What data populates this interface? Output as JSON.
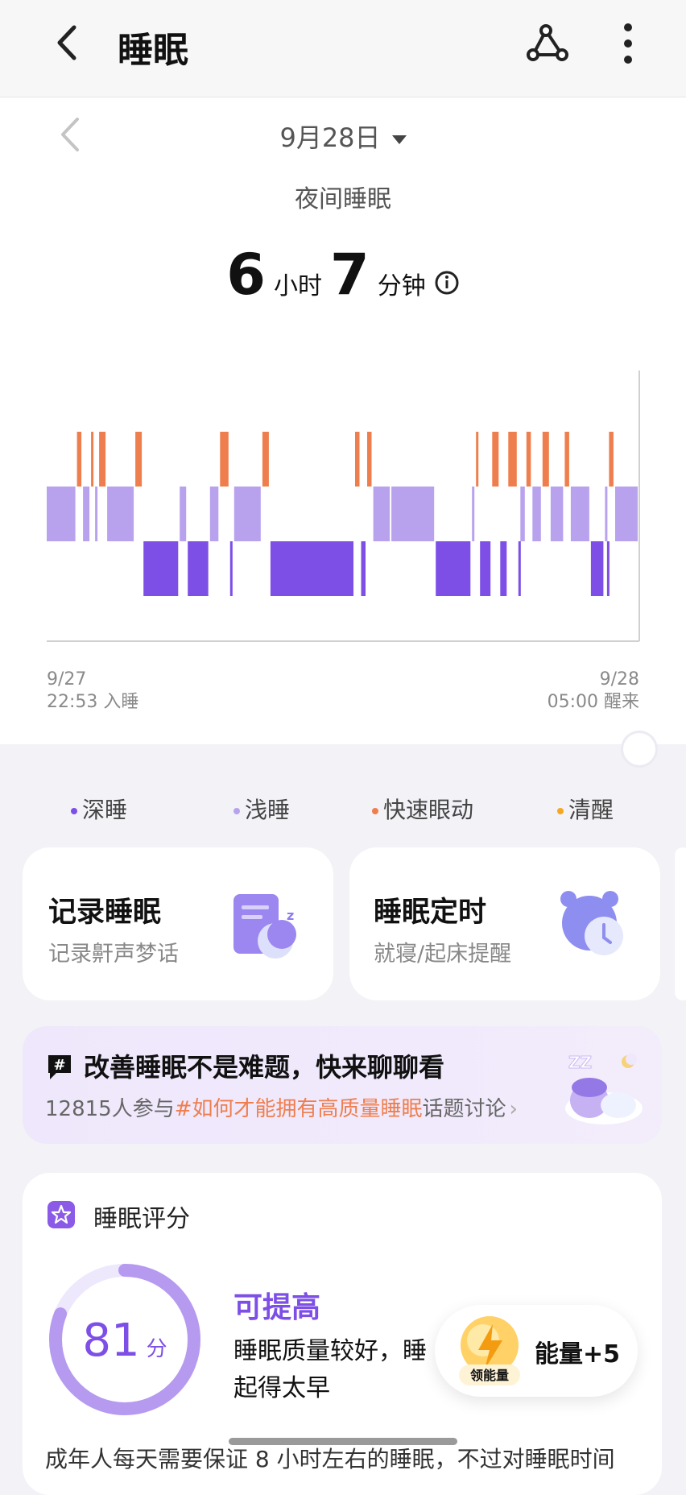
{
  "header": {
    "title": "睡眠",
    "back_icon": "chevron-left-icon",
    "share_icon": "share-nodes-icon",
    "more_icon": "more-vertical-icon"
  },
  "date_nav": {
    "date": "9月28日"
  },
  "summary": {
    "subtitle": "夜间睡眠",
    "hours": "6",
    "hours_unit": "小时",
    "minutes": "7",
    "minutes_unit": "分钟"
  },
  "chart": {
    "start_date": "9/27",
    "start_label": "22:53 入睡",
    "end_date": "9/28",
    "end_label": "05:00 醒来",
    "colors": {
      "deep": "#7d4fe6",
      "light": "#b8a2ee",
      "rem": "#ef7e4e",
      "awake": "#f5a623"
    },
    "segments": [
      {
        "stage": "light",
        "start": 0,
        "end": 15
      },
      {
        "stage": "rem",
        "start": 15,
        "end": 18
      },
      {
        "stage": "light",
        "start": 18,
        "end": 22
      },
      {
        "stage": "rem",
        "start": 22,
        "end": 24
      },
      {
        "stage": "light",
        "start": 24,
        "end": 26
      },
      {
        "stage": "rem",
        "start": 26,
        "end": 30
      },
      {
        "stage": "light",
        "start": 30,
        "end": 44
      },
      {
        "stage": "rem",
        "start": 44,
        "end": 48
      },
      {
        "stage": "deep",
        "start": 48,
        "end": 66
      },
      {
        "stage": "light",
        "start": 66,
        "end": 70
      },
      {
        "stage": "deep",
        "start": 70,
        "end": 81
      },
      {
        "stage": "light",
        "start": 81,
        "end": 86
      },
      {
        "stage": "rem",
        "start": 86,
        "end": 91
      },
      {
        "stage": "deep",
        "start": 91,
        "end": 93
      },
      {
        "stage": "light",
        "start": 93,
        "end": 107
      },
      {
        "stage": "rem",
        "start": 107,
        "end": 111
      },
      {
        "stage": "deep",
        "start": 111,
        "end": 153
      },
      {
        "stage": "rem",
        "start": 153,
        "end": 156
      },
      {
        "stage": "deep",
        "start": 156,
        "end": 159
      },
      {
        "stage": "rem",
        "start": 159,
        "end": 162
      },
      {
        "stage": "light",
        "start": 162,
        "end": 171
      },
      {
        "stage": "light",
        "start": 171,
        "end": 193
      },
      {
        "stage": "deep",
        "start": 193,
        "end": 211
      },
      {
        "stage": "light",
        "start": 211,
        "end": 213
      },
      {
        "stage": "rem",
        "start": 213,
        "end": 215
      },
      {
        "stage": "deep",
        "start": 215,
        "end": 221
      },
      {
        "stage": "rem",
        "start": 221,
        "end": 225
      },
      {
        "stage": "deep",
        "start": 225,
        "end": 229
      },
      {
        "stage": "rem",
        "start": 229,
        "end": 234
      },
      {
        "stage": "deep",
        "start": 234,
        "end": 235
      },
      {
        "stage": "light",
        "start": 235,
        "end": 238
      },
      {
        "stage": "rem",
        "start": 238,
        "end": 241
      },
      {
        "stage": "light",
        "start": 241,
        "end": 246
      },
      {
        "stage": "rem",
        "start": 246,
        "end": 250
      },
      {
        "stage": "light",
        "start": 250,
        "end": 257
      },
      {
        "stage": "rem",
        "start": 257,
        "end": 260
      },
      {
        "stage": "light",
        "start": 260,
        "end": 270
      },
      {
        "stage": "deep",
        "start": 270,
        "end": 277
      },
      {
        "stage": "light",
        "start": 277,
        "end": 278
      },
      {
        "stage": "deep",
        "start": 278,
        "end": 279
      },
      {
        "stage": "rem",
        "start": 279,
        "end": 282
      },
      {
        "stage": "light",
        "start": 282,
        "end": 294
      }
    ]
  },
  "legend": [
    {
      "label": "深睡",
      "color": "#7d4fe6"
    },
    {
      "label": "浅睡",
      "color": "#b8a2ee"
    },
    {
      "label": "快速眼动",
      "color": "#ef7e4e"
    },
    {
      "label": "清醒",
      "color": "#f5a623"
    }
  ],
  "cards": [
    {
      "title": "记录睡眠",
      "subtitle": "记录鼾声梦话",
      "icon": "sleep-record-icon"
    },
    {
      "title": "睡眠定时",
      "subtitle": "就寝/起床提醒",
      "icon": "alarm-clock-icon"
    }
  ],
  "topic": {
    "title": "改善睡眠不是难题，快来聊聊看",
    "count_text": "12815人参与",
    "hashtag": "#如何才能拥有高质量睡眠",
    "suffix": "话题讨论",
    "badge": "#"
  },
  "score": {
    "title": "睡眠评分",
    "value": "81",
    "value_num": 81,
    "unit": "分",
    "level": "可提高",
    "desc_line1": "睡眠质量较好，睡",
    "desc_line2": "起得太早",
    "bottom_text": "成年人每天需要保证 8 小时左右的睡眠，不过对睡眠时间"
  },
  "energy": {
    "label": "能量+5",
    "badge": "领能量"
  }
}
